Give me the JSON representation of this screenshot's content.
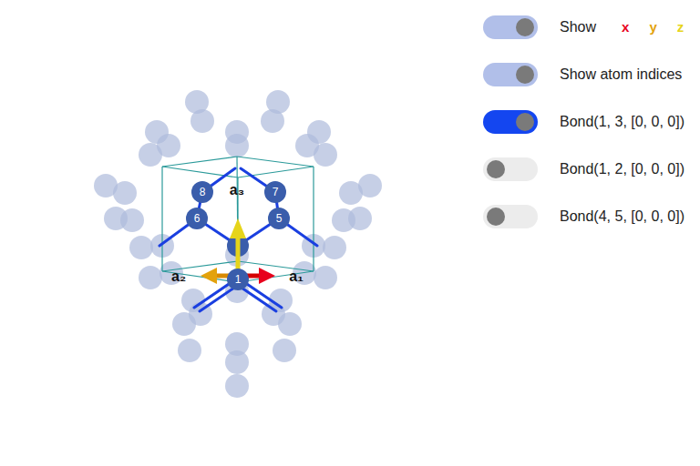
{
  "viewer": {
    "cell_vectors": [
      {
        "label": "a₁"
      },
      {
        "label": "a₂"
      },
      {
        "label": "a₃"
      }
    ],
    "atoms": [
      {
        "index": "8"
      },
      {
        "index": "7"
      },
      {
        "index": "6"
      },
      {
        "index": "5"
      },
      {
        "index": "1"
      }
    ]
  },
  "controls": [
    {
      "kind": "axes",
      "label": "Show",
      "on": true,
      "axes": [
        {
          "label": "x",
          "color": "#e8001c"
        },
        {
          "label": "y",
          "color": "#e3a20c"
        },
        {
          "label": "z",
          "color": "#e6d41a"
        }
      ]
    },
    {
      "kind": "switch",
      "label": "Show atom indices",
      "on": true
    },
    {
      "kind": "bond",
      "label": "Bond(1, 3, [0, 0, 0])",
      "on": true
    },
    {
      "kind": "bond",
      "label": "Bond(1, 2, [0, 0, 0])",
      "on": false
    },
    {
      "kind": "bond",
      "label": "Bond(4, 5, [0, 0, 0])",
      "on": false
    }
  ]
}
